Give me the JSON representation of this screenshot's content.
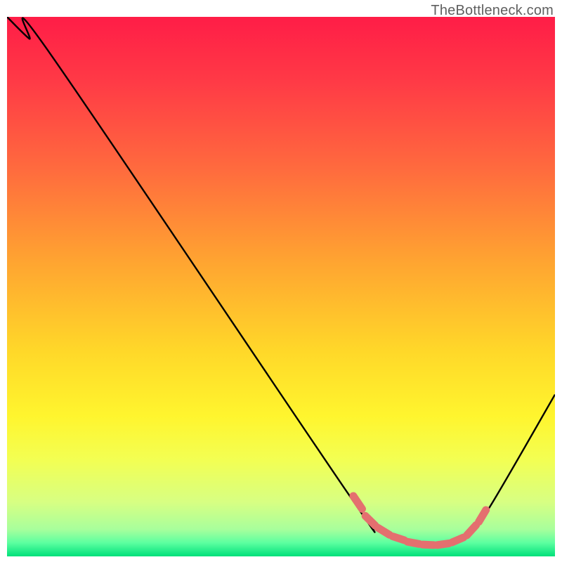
{
  "watermark": "TheBottleneck.com",
  "chart_data": {
    "type": "line",
    "title": "",
    "xlabel": "",
    "ylabel": "",
    "xlim": [
      0,
      100
    ],
    "ylim": [
      0,
      100
    ],
    "series": [
      {
        "name": "bottleneck-curve",
        "x": [
          0,
          4,
          8,
          62,
          66,
          72,
          80,
          84,
          88,
          100
        ],
        "y": [
          100,
          96,
          93,
          12,
          7,
          3,
          2,
          4,
          9,
          30
        ]
      }
    ],
    "markers": {
      "name": "optimal-range-dashes",
      "segments": [
        [
          [
            63.2,
            11.2
          ],
          [
            64.8,
            8.8
          ]
        ],
        [
          [
            65.4,
            7.5
          ],
          [
            67.2,
            5.7
          ]
        ],
        [
          [
            67.7,
            5.3
          ],
          [
            69.8,
            4.0
          ]
        ],
        [
          [
            70.4,
            3.7
          ],
          [
            72.5,
            3.0
          ]
        ],
        [
          [
            73.1,
            2.7
          ],
          [
            75.2,
            2.3
          ]
        ],
        [
          [
            75.8,
            2.2
          ],
          [
            77.9,
            2.1
          ]
        ],
        [
          [
            78.5,
            2.1
          ],
          [
            80.6,
            2.4
          ]
        ],
        [
          [
            81.2,
            2.6
          ],
          [
            83.3,
            3.5
          ]
        ],
        [
          [
            83.9,
            3.9
          ],
          [
            85.6,
            5.8
          ]
        ],
        [
          [
            86.1,
            6.4
          ],
          [
            87.4,
            8.6
          ]
        ]
      ]
    },
    "background_gradient": {
      "stops": [
        {
          "offset": 0.0,
          "color": "#ff1d47"
        },
        {
          "offset": 0.12,
          "color": "#ff3a46"
        },
        {
          "offset": 0.28,
          "color": "#ff6a3e"
        },
        {
          "offset": 0.45,
          "color": "#ffa331"
        },
        {
          "offset": 0.62,
          "color": "#ffd829"
        },
        {
          "offset": 0.74,
          "color": "#fff52e"
        },
        {
          "offset": 0.82,
          "color": "#f3ff52"
        },
        {
          "offset": 0.9,
          "color": "#d7ff83"
        },
        {
          "offset": 0.95,
          "color": "#a8ff9c"
        },
        {
          "offset": 0.975,
          "color": "#5cffa0"
        },
        {
          "offset": 1.0,
          "color": "#00e07a"
        }
      ]
    },
    "marker_color": "#e46f6f",
    "curve_color": "#000000"
  }
}
